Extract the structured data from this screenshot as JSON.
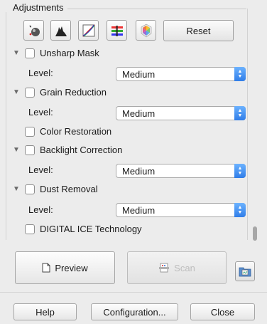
{
  "section": {
    "title": "Adjustments"
  },
  "toolbar": {
    "buttons": [
      "auto-exposure-icon",
      "histogram-icon",
      "tone-curve-icon",
      "image-adjustment-icon",
      "color-palette-icon"
    ],
    "reset_label": "Reset"
  },
  "adjustments": {
    "unsharp_mask": {
      "label": "Unsharp Mask",
      "checked": false,
      "level_label": "Level:",
      "level_value": "Medium"
    },
    "grain_reduction": {
      "label": "Grain Reduction",
      "checked": false,
      "level_label": "Level:",
      "level_value": "Medium"
    },
    "color_restoration": {
      "label": "Color Restoration",
      "checked": false
    },
    "backlight_correction": {
      "label": "Backlight Correction",
      "checked": false,
      "level_label": "Level:",
      "level_value": "Medium"
    },
    "dust_removal": {
      "label": "Dust Removal",
      "checked": false,
      "level_label": "Level:",
      "level_value": "Medium"
    },
    "digital_ice": {
      "label": "DIGITAL ICE Technology",
      "checked": false
    }
  },
  "actions": {
    "preview_label": "Preview",
    "scan_label": "Scan"
  },
  "footer": {
    "help_label": "Help",
    "configuration_label": "Configuration...",
    "close_label": "Close"
  },
  "colors": {
    "select_arrow": "#2f7de8",
    "window_bg": "#ececec"
  }
}
